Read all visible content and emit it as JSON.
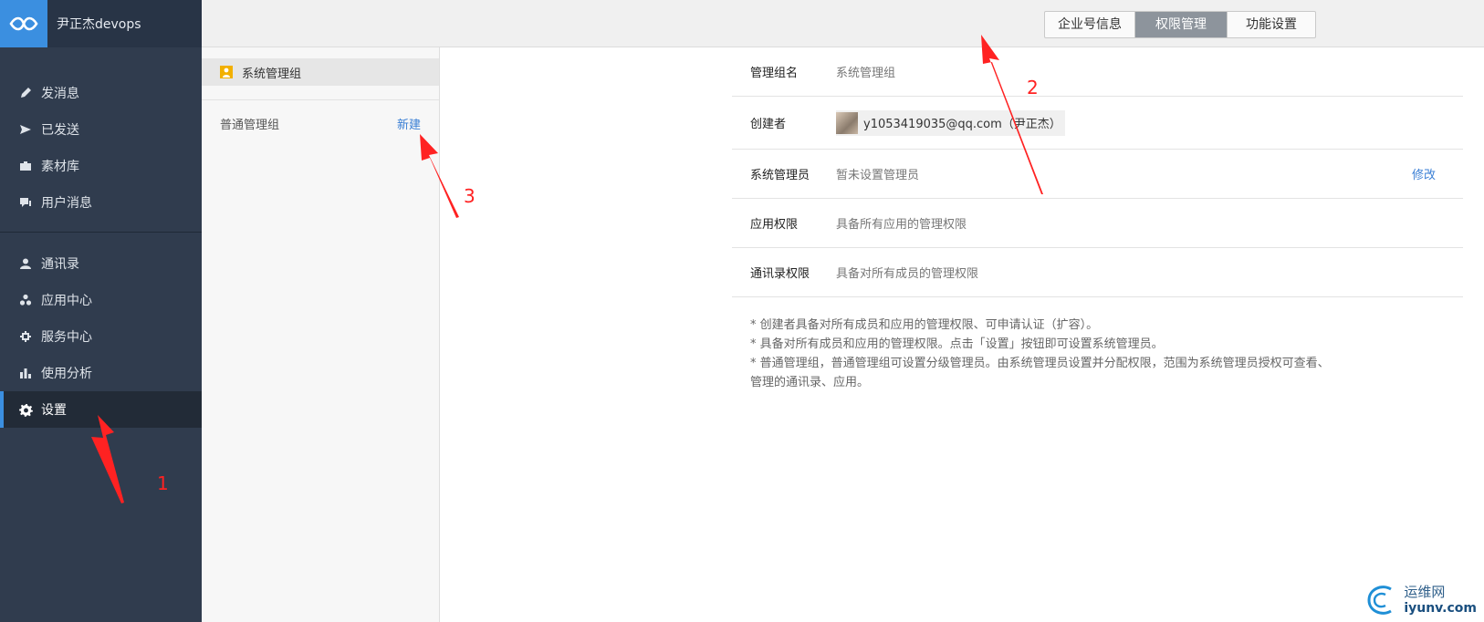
{
  "brand": {
    "name": "尹正杰devops"
  },
  "sidebar": {
    "group1": [
      {
        "label": "发消息",
        "icon": "pencil-icon"
      },
      {
        "label": "已发送",
        "icon": "send-icon"
      },
      {
        "label": "素材库",
        "icon": "briefcase-icon"
      },
      {
        "label": "用户消息",
        "icon": "chat-icon"
      }
    ],
    "group2": [
      {
        "label": "通讯录",
        "icon": "user-icon"
      },
      {
        "label": "应用中心",
        "icon": "apps-icon"
      },
      {
        "label": "服务中心",
        "icon": "service-icon"
      },
      {
        "label": "使用分析",
        "icon": "bar-chart-icon"
      },
      {
        "label": "设置",
        "icon": "gear-icon",
        "active": true
      }
    ]
  },
  "tabs": [
    {
      "label": "企业号信息"
    },
    {
      "label": "权限管理",
      "active": true
    },
    {
      "label": "功能设置"
    }
  ],
  "groups": {
    "system": "系统管理组",
    "normal": "普通管理组",
    "new_link": "新建"
  },
  "detail": {
    "rows": [
      {
        "key": "管理组名",
        "value": "系统管理组"
      },
      {
        "key": "创建者",
        "value": "y1053419035@qq.com（尹正杰）"
      },
      {
        "key": "系统管理员",
        "value": "暂未设置管理员",
        "action": "修改"
      },
      {
        "key": "应用权限",
        "value": "具备所有应用的管理权限"
      },
      {
        "key": "通讯录权限",
        "value": "具备对所有成员的管理权限"
      }
    ],
    "notes": [
      "* 创建者具备对所有成员和应用的管理权限、可申请认证（扩容）。",
      "* 具备对所有成员和应用的管理权限。点击「设置」按钮即可设置系统管理员。",
      "* 普通管理组，普通管理组可设置分级管理员。由系统管理员设置并分配权限，范围为系统管理员授权可查看、管理的通讯录、应用。"
    ]
  },
  "annotations": [
    "1",
    "2",
    "3"
  ],
  "watermark": {
    "cn": "运维网",
    "en": "iyunv.com"
  },
  "colors": {
    "sidebar_bg": "#303c4e",
    "accent": "#3b8fe0",
    "link": "#3a7fd5",
    "annotation": "#ff2222",
    "tab_active": "#8d949c"
  }
}
